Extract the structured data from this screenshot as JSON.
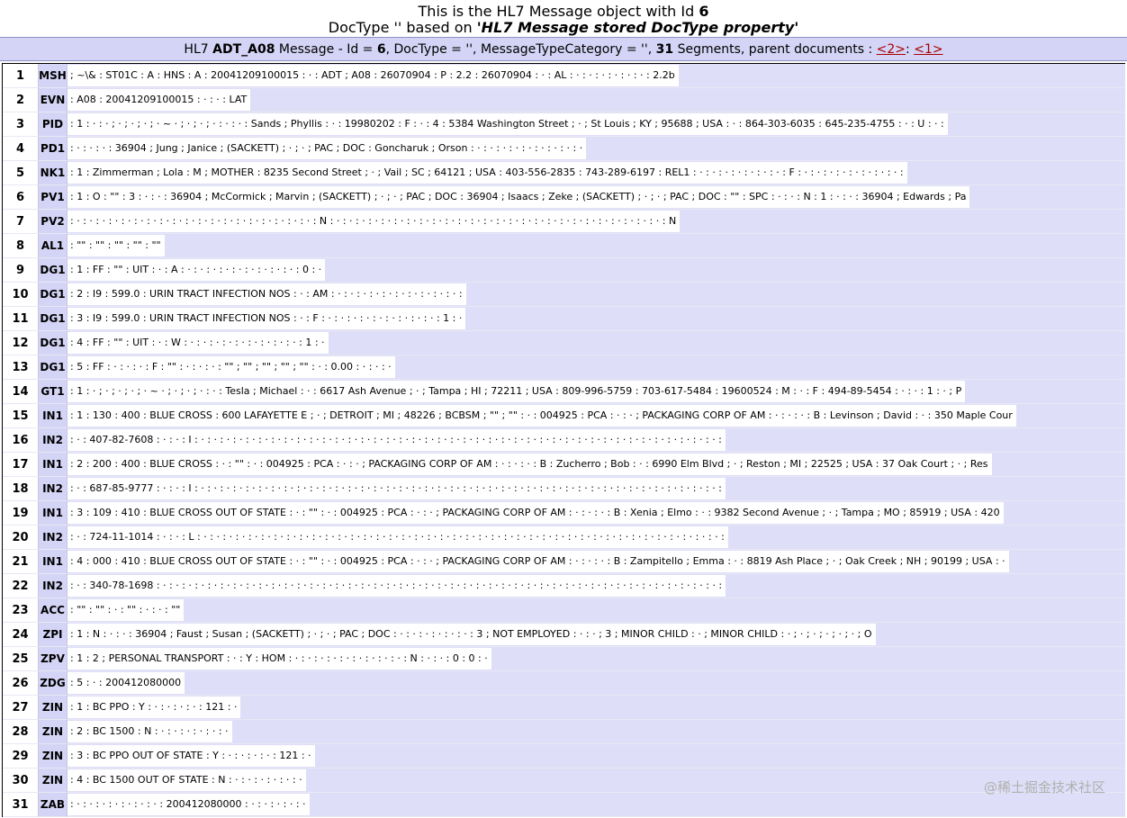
{
  "header": {
    "line1_prefix": "This is the HL7 Message object with Id ",
    "line1_id": "6",
    "line2_prefix": "DocType '' based on ",
    "line2_emph": "'HL7 Message stored DocType property'"
  },
  "summary": {
    "p1": "HL7 ",
    "msgtype": "ADT_A08",
    "p2": " Message - Id = ",
    "id": "6",
    "p3": ", DocType = '', MessageTypeCategory = '', ",
    "count": "31",
    "p4": " Segments, parent documents : ",
    "link1": "<2>",
    "sep": ": ",
    "link2": "<1>"
  },
  "segments": [
    {
      "n": "1",
      "code": "MSH",
      "fields": "; ~\\& : ST01C : A : HNS : A : 20041209100015 : · : ADT ; A08 : 26070904 : P : 2.2 : 26070904 : · : AL : · : · : · : · : · : · : 2.2b"
    },
    {
      "n": "2",
      "code": "EVN",
      "fields": ": A08 : 20041209100015 : · : · : LAT"
    },
    {
      "n": "3",
      "code": "PID",
      "fields": ": 1 : · : · ; · ; · ; · ; · ~ · ; · ; · ; · : · : · : Sands ; Phyllis : · : 19980202 : F : · : 4 : 5384 Washington Street ; · ; St Louis ; KY ; 95688 ; USA : · : 864-303-6035 : 645-235-4755 : · : U : · :"
    },
    {
      "n": "4",
      "code": "PD1",
      "fields": ": · : · : · : 36904 ; Jung ; Janice ; (SACKETT) ; · ; · ; PAC ; DOC : Goncharuk ; Orson : · : · : · : · : · : · : · : · : ·"
    },
    {
      "n": "5",
      "code": "NK1",
      "fields": ": 1 : Zimmerman ; Lola : M ; MOTHER : 8235 Second Street ; · ; Vail ; SC ; 64121 ; USA : 403-556-2835 : 743-289-6197 : REL1 : · : · : · : · : · : · : · : F : · : · : · : · : · : · : · : · :"
    },
    {
      "n": "6",
      "code": "PV1",
      "fields": ": 1 : O : \"\" : 3 : · : · : 36904 ; McCormick ; Marvin ; (SACKETT) ; · ; · ; PAC ; DOC : 36904 ; Isaacs ; Zeke ; (SACKETT) ; · ; · ; PAC ; DOC : \"\" : SPC : · : · : N : 1 : · : · : 36904 ; Edwards ; Pa"
    },
    {
      "n": "7",
      "code": "PV2",
      "fields": ": · : · : · : · : · : · : · : · : · : · : · : · : · : · : · : · : · : · : · : N : · : · : · : · : · : · : · : · : · : · : · : · : · : · : · : · : · : · : · : · : · : · : · : · : · : · : N"
    },
    {
      "n": "8",
      "code": "AL1",
      "fields": ": \"\" : \"\" : \"\" : \"\" : \"\""
    },
    {
      "n": "9",
      "code": "DG1",
      "fields": ": 1 : FF : \"\" : UIT : · : A : · : · : · : · : · : · : · : · : · : 0 : ·"
    },
    {
      "n": "10",
      "code": "DG1",
      "fields": ": 2 : I9 : 599.0 : URIN TRACT INFECTION NOS : · : AM : · : · : · : · : · : · : · : · : · : · :"
    },
    {
      "n": "11",
      "code": "DG1",
      "fields": ": 3 : I9 : 599.0 : URIN TRACT INFECTION NOS : · : F : · : · : · : · : · : · : · : · : · : 1 : ·"
    },
    {
      "n": "12",
      "code": "DG1",
      "fields": ": 4 : FF : \"\" : UIT : · : W : · : · : · : · : · : · : · : · : · : 1 : ·"
    },
    {
      "n": "13",
      "code": "DG1",
      "fields": ": 5 : FF : · : · : · : F : \"\" : · : · : · : \"\" ; \"\" ; \"\" ; \"\" ; \"\" : · : 0.00 : · : · : ·"
    },
    {
      "n": "14",
      "code": "GT1",
      "fields": ": 1 : · ; · ; · ; · ; · ~ · ; · ; · ; · : · : Tesla ; Michael : · : 6617 Ash Avenue ; · ; Tampa ; HI ; 72211 ; USA : 809-996-5759 : 703-617-5484 : 19600524 : M : · : F : 494-89-5454 : · : · : 1 : · ; P"
    },
    {
      "n": "15",
      "code": "IN1",
      "fields": ": 1 : 130 : 400 : BLUE CROSS : 600 LAFAYETTE E ; · ; DETROIT ; MI ; 48226 ; BCBSM ; \"\" ; \"\" : · : 004925 : PCA : · : · ; PACKAGING CORP OF AM : · : · : · : B : Levinson ; David : · : 350 Maple Cour"
    },
    {
      "n": "16",
      "code": "IN2",
      "fields": ": · : 407-82-7608 : · : · : I : · : · : · : · : · : · : · : · : · : · : · : · : · : · : · : · : · : · : · : · : · : · : · : · : · : · : · : · : · : · : · : · : · : · : · : · : · : · : · : · : · :"
    },
    {
      "n": "17",
      "code": "IN1",
      "fields": ": 2 : 200 : 400 : BLUE CROSS : · : \"\" : · : 004925 : PCA : · : · ; PACKAGING CORP OF AM : · : · : · : B : Zucherro ; Bob : · : 6990 Elm Blvd ; · ; Reston ; MI ; 22525 ; USA : 37 Oak Court ; · ; Res"
    },
    {
      "n": "18",
      "code": "IN2",
      "fields": ": · : 687-85-9777 : · : · : I : · : · : · : · : · : · : · : · : · : · : · : · : · : · : · : · : · : · : · : · : · : · : · : · : · : · : · : · : · : · : · : · : · : · : · : · : · : · : · : · : · :"
    },
    {
      "n": "19",
      "code": "IN1",
      "fields": ": 3 : 109 : 410 : BLUE CROSS OUT OF STATE : · : \"\" : · : 004925 : PCA : · : · ; PACKAGING CORP OF AM : · : · : · : B : Xenia ; Elmo : · : 9382 Second Avenue ; · ; Tampa ; MO ; 85919 ; USA : 420"
    },
    {
      "n": "20",
      "code": "IN2",
      "fields": ": · : 724-11-1014 : · : · : L : · : · : · : · : · : · : · : · : · : · : · : · : · : · : · : · : · : · : · : · : · : · : · : · : · : · : · : · : · : · : · : · : · : · : · : · : · : · : · : · : · :"
    },
    {
      "n": "21",
      "code": "IN1",
      "fields": ": 4 : 000 : 410 : BLUE CROSS OUT OF STATE : · : \"\" : · : 004925 : PCA : · : · ; PACKAGING CORP OF AM : · : · : · : B : Zampitello ; Emma : · : 8819 Ash Place ; · ; Oak Creek ; NH ; 90199 ; USA : ·"
    },
    {
      "n": "22",
      "code": "IN2",
      "fields": ": · : 340-78-1698 : · : · : · : · : · : · : · : · : · : · : · : · : · : · : · : · : · : · : · : · : · : · : · : · : · : · : · : · : · : · : · : · : · : · : · : · : · : · : · : · : · : · : · : · :"
    },
    {
      "n": "23",
      "code": "ACC",
      "fields": ": \"\" : \"\" : · : \"\" : · : · : \"\""
    },
    {
      "n": "24",
      "code": "ZPI",
      "fields": ": 1 : N : · : · : 36904 ; Faust ; Susan ; (SACKETT) ; · ; · ; PAC ; DOC : · : · : · : · : · : · : 3 ; NOT EMPLOYED : · : · ; 3 ; MINOR CHILD : · ; MINOR CHILD : · ; · ; · ; · ; · ; · ; O"
    },
    {
      "n": "25",
      "code": "ZPV",
      "fields": ": 1 : 2 ; PERSONAL TRANSPORT : · : Y : HOM : · : · : · : · : · : · : · : · : · : N : · : · : 0 : 0 : ·"
    },
    {
      "n": "26",
      "code": "ZDG",
      "fields": ": 5 : · : 200412080000"
    },
    {
      "n": "27",
      "code": "ZIN",
      "fields": ": 1 : BC PPO : Y : · : · : · : · : 121 : ·"
    },
    {
      "n": "28",
      "code": "ZIN",
      "fields": ": 2 : BC 1500 : N : · : · : · : · : · : ·"
    },
    {
      "n": "29",
      "code": "ZIN",
      "fields": ": 3 : BC PPO OUT OF STATE : Y : · : · : · : · : 121 : ·"
    },
    {
      "n": "30",
      "code": "ZIN",
      "fields": ": 4 : BC 1500 OUT OF STATE : N : · : · : · : · : · : ·"
    },
    {
      "n": "31",
      "code": "ZAB",
      "fields": ": · : · : · : · : · : · : · : 200412080000 : · : · : · : · : ·"
    }
  ],
  "watermark": "@稀土掘金技术社区"
}
